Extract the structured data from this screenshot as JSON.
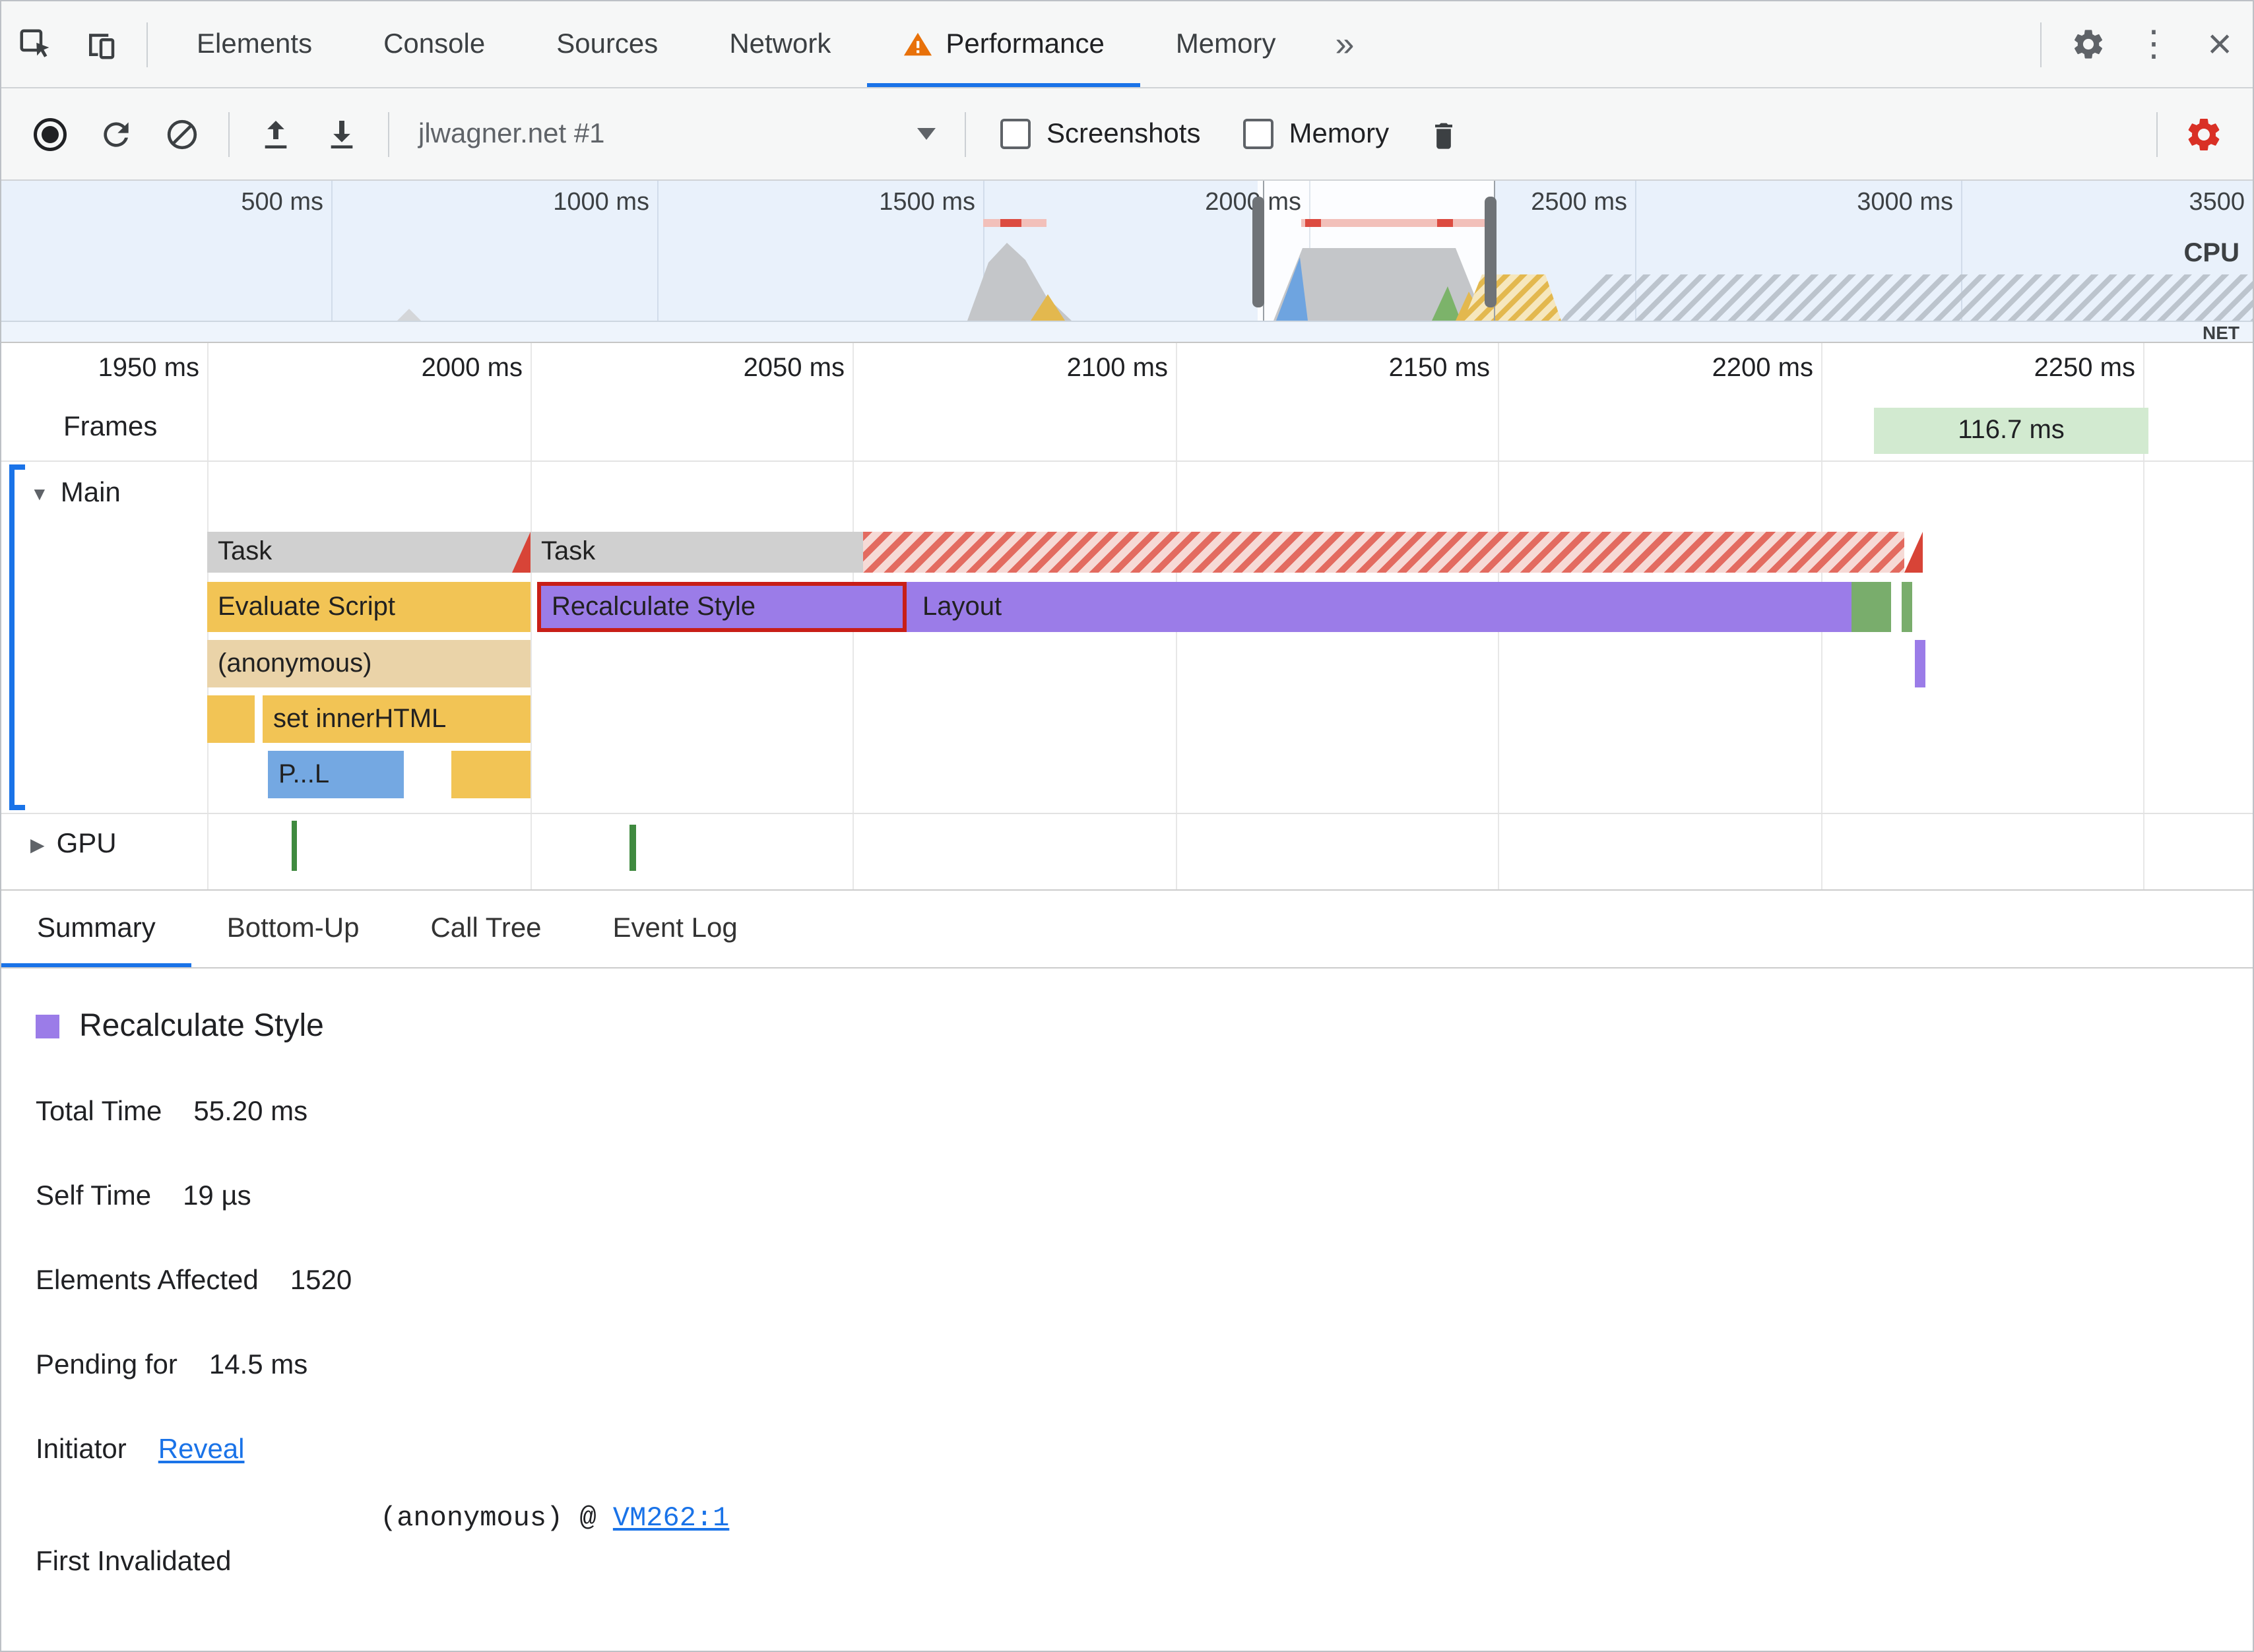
{
  "tabs_bar": {
    "items": [
      {
        "label": "Elements"
      },
      {
        "label": "Console"
      },
      {
        "label": "Sources"
      },
      {
        "label": "Network"
      },
      {
        "label": "Performance"
      },
      {
        "label": "Memory"
      }
    ],
    "more_label": "»"
  },
  "toolbar": {
    "profile_name": "jlwagner.net #1",
    "screenshots_label": "Screenshots",
    "memory_label": "Memory"
  },
  "overview": {
    "ruler": [
      "500 ms",
      "1000 ms",
      "1500 ms",
      "2000 ms",
      "2500 ms",
      "3000 ms",
      "3500"
    ],
    "cpu_label": "CPU",
    "net_label": "NET"
  },
  "timeline": {
    "ruler": [
      "1950 ms",
      "2000 ms",
      "2050 ms",
      "2100 ms",
      "2150 ms",
      "2200 ms",
      "2250 ms"
    ],
    "frames_label": "Frames",
    "frame_value": "116.7 ms",
    "main_label": "Main",
    "gpu_label": "GPU",
    "bars": {
      "task1": "Task",
      "task2": "Task",
      "evaluate_script": "Evaluate Script",
      "recalculate_style": "Recalculate Style",
      "layout": "Layout",
      "anonymous": "(anonymous)",
      "set_innerhtml": "set innerHTML",
      "profile_call": "P...L"
    }
  },
  "bottom_tabs": [
    {
      "label": "Summary"
    },
    {
      "label": "Bottom-Up"
    },
    {
      "label": "Call Tree"
    },
    {
      "label": "Event Log"
    }
  ],
  "summary": {
    "title": "Recalculate Style",
    "total_time_label": "Total Time",
    "total_time": "55.20 ms",
    "self_time_label": "Self Time",
    "self_time": "19 µs",
    "elements_affected_label": "Elements Affected",
    "elements_affected": "1520",
    "pending_label": "Pending for",
    "pending": "14.5 ms",
    "initiator_label": "Initiator",
    "initiator_link": "Reveal",
    "first_invalidated_label": "First Invalidated",
    "first_invalidated_text": "(anonymous) @ ",
    "first_invalidated_link": "VM262:1"
  },
  "colors": {
    "accent": "#1a73e8",
    "warning_orange": "#e8710a",
    "settings_alert_red": "#d93025",
    "rendering_purple": "#9b7ce8",
    "scripting_yellow": "#f2c455",
    "painting_green": "#79ad6c",
    "frame_green": "#d2ead0",
    "task_gray": "#d0d0d0",
    "long_task_red": "#e36b60",
    "selection_border_red": "#c81e17",
    "parse_blue": "#74a8e2",
    "anonymous_tan": "#ead3a8"
  }
}
